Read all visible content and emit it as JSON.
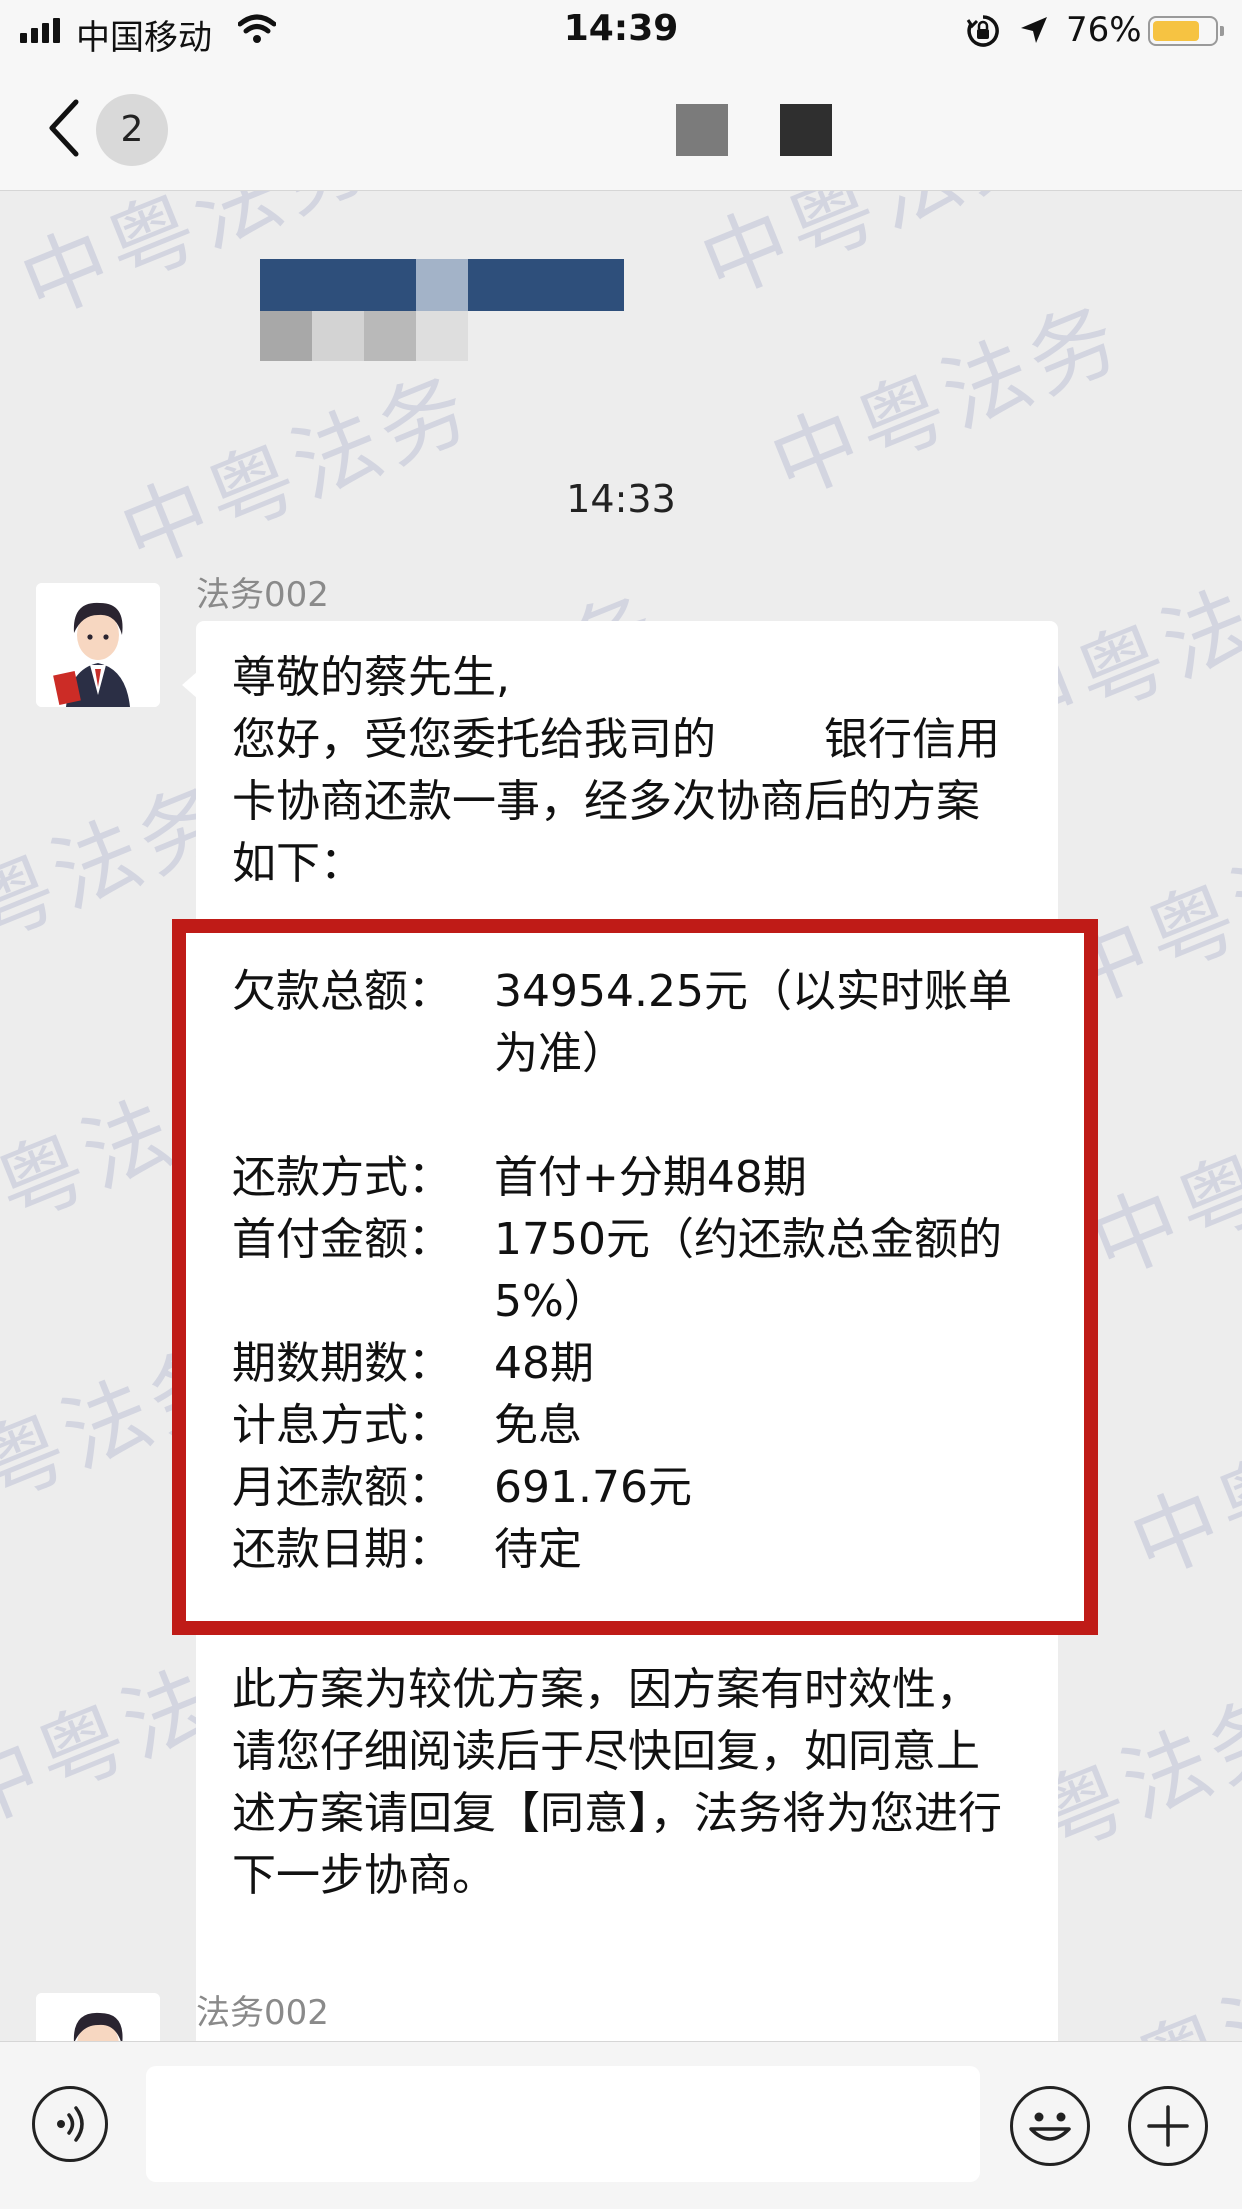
{
  "status_bar": {
    "carrier": "中国移动",
    "time": "14:39",
    "battery_percent": "76%",
    "battery_level": 0.76,
    "icons": [
      "signal-icon",
      "wifi-icon",
      "orientation-lock-icon",
      "location-arrow-icon",
      "battery-icon"
    ]
  },
  "nav": {
    "unread_count": "2",
    "icons": [
      "back-chevron-icon"
    ]
  },
  "chat": {
    "timestamp": "14:33",
    "message": {
      "sender": "法务002",
      "greeting": "尊敬的蔡先生,",
      "intro_a": "您好，受您委托给我司的",
      "intro_b": "银行信用卡协商还款一事，经多次协商后的方案如下：",
      "plan": [
        {
          "label": "欠款总额：",
          "value": "34954.25元（以实时账单为准）"
        },
        {
          "label": "还款方式：",
          "value": "首付+分期48期"
        },
        {
          "label": "首付金额：",
          "value": "1750元（约还款总金额的5%）"
        },
        {
          "label": "期数期数：",
          "value": "48期"
        },
        {
          "label": "计息方式：",
          "value": "免息"
        },
        {
          "label": "月还款额：",
          "value": "691.76元"
        },
        {
          "label": "还款日期：",
          "value": "待定"
        }
      ],
      "closing": "此方案为较优方案，因方案有时效性，请您仔细阅读后于尽快回复，如同意上述方案请回复【同意】，法务将为您进行下一步协商。"
    },
    "next_sender": "法务002",
    "watermark": "中粤法务"
  },
  "input_bar": {
    "icons": [
      "voice-icon",
      "emoji-icon",
      "plus-icon"
    ],
    "text_value": ""
  },
  "colors": {
    "status_nav_bg": "#f7f7f7",
    "chat_bg": "#ededed",
    "bubble_bg": "#ffffff",
    "highlight_border": "#bf1b17",
    "battery_fill": "#f6c342",
    "watermark": "#7680b2"
  }
}
